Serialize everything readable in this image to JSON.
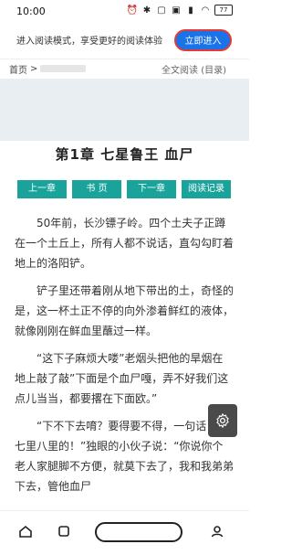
{
  "status_bar": {
    "time": "10:00",
    "battery": "77",
    "icons": [
      "alarm-icon",
      "bluetooth-icon",
      "nfc-icon",
      "hd-icon",
      "signal-icon",
      "wifi-icon",
      "battery-icon"
    ]
  },
  "banner": {
    "text": "进入阅读模式，享受更好的阅读体验",
    "button_label": "立即进入"
  },
  "breadcrumb": {
    "home": "首页",
    "sep": ">",
    "right": "全文阅读 (目录)"
  },
  "chapter": {
    "title": "第1章 七星鲁王 血尸"
  },
  "nav": {
    "prev": "上一章",
    "book": "书 页",
    "next": "下一章",
    "record": "阅读记录"
  },
  "content": {
    "p1": "50年前，长沙镖子岭。四个土夫子正蹲在一个土丘上，所有人都不说话，直勾勾盯着地上的洛阳铲。",
    "p2": "铲子里还带着刚从地下带出的土，奇怪的是，这一杯土正不停的向外渗着鲜红的液体，就像刚刚在鲜血里蘸过一样。",
    "p3": "“这下子麻烦大喽”老烟头把他的旱烟在地上敲了敲”下面是个血尸嘎，弄不好我们这点儿当当，都要撂在下面欧。”",
    "p4": "“下不下去唷？要得要不得，一句话，莫七里八里的！”独眼的小伙子说：“你说你个老人家腿脚不方便，就莫下去了，我和我弟弟下去，管他血尸"
  },
  "colors": {
    "accent_blue": "#1a73e8",
    "nav_teal": "#1aa39b",
    "highlight_red": "#e53935"
  }
}
